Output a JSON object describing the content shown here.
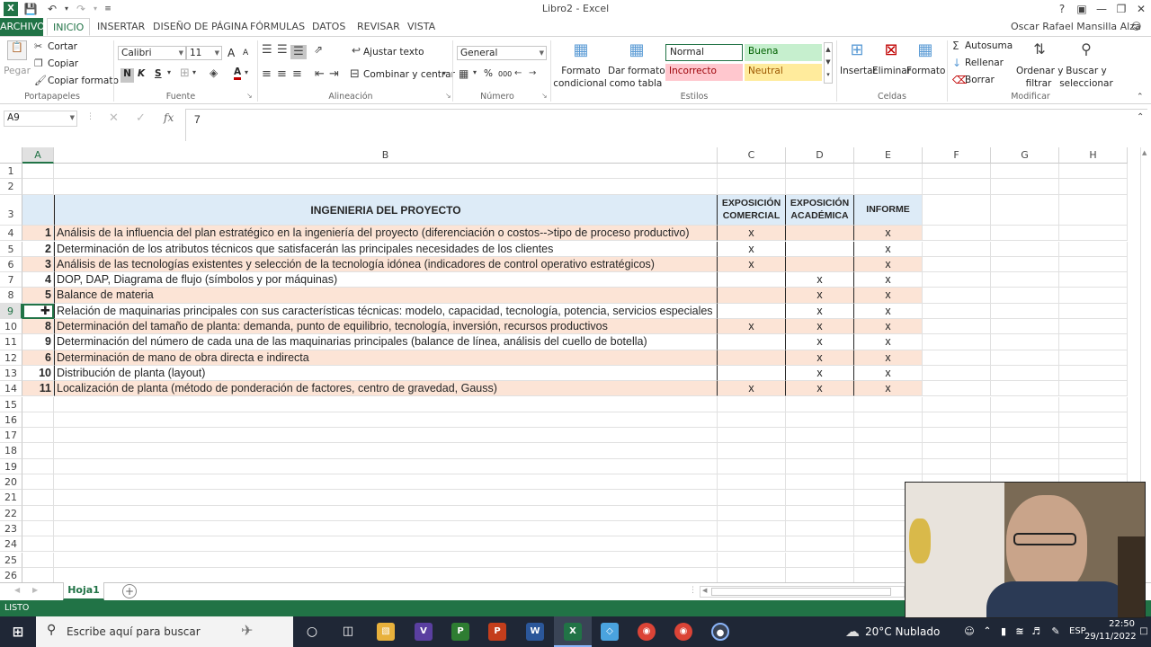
{
  "window": {
    "title": "Libro2 - Excel",
    "user": "Oscar Rafael Mansilla Alza",
    "help": "?"
  },
  "tabs": [
    "ARCHIVO",
    "INICIO",
    "INSERTAR",
    "DISEÑO DE PÁGINA",
    "FÓRMULAS",
    "DATOS",
    "REVISAR",
    "VISTA"
  ],
  "ribbon": {
    "clipboard": {
      "paste": "Pegar",
      "cut": "Cortar",
      "copy": "Copiar",
      "copy_format": "Copiar formato",
      "label": "Portapapeles"
    },
    "font": {
      "name": "Calibri",
      "size": "11",
      "bold": "N",
      "italic": "K",
      "underline": "S",
      "grow": "A",
      "shrink": "A",
      "color": "A",
      "label": "Fuente"
    },
    "alignment": {
      "wrap": "Ajustar texto",
      "merge": "Combinar y centrar",
      "label": "Alineación"
    },
    "number": {
      "format": "General",
      "percent": "%",
      "thousands": "000",
      "label": "Número"
    },
    "styles": {
      "cond_format_1": "Formato",
      "cond_format_2": "condicional",
      "table_format_1": "Dar formato",
      "table_format_2": "como tabla",
      "normal": "Normal",
      "good": "Buena",
      "bad": "Incorrecto",
      "neutral": "Neutral",
      "label": "Estilos"
    },
    "cells": {
      "insert": "Insertar",
      "delete": "Eliminar",
      "format": "Formato",
      "label": "Celdas"
    },
    "editing": {
      "autosum": "Autosuma",
      "fill": "Rellenar",
      "clear": "Borrar",
      "sort_1": "Ordenar y",
      "sort_2": "filtrar",
      "find_1": "Buscar y",
      "find_2": "seleccionar",
      "label": "Modificar"
    }
  },
  "formula_bar": {
    "name_box": "A9",
    "fx": "fx",
    "value": "7"
  },
  "columns": [
    "A",
    "B",
    "C",
    "D",
    "E",
    "F",
    "G",
    "H"
  ],
  "rows": [
    "1",
    "2",
    "3",
    "4",
    "5",
    "6",
    "7",
    "8",
    "9",
    "10",
    "11",
    "12",
    "13",
    "14",
    "15",
    "16",
    "17",
    "18",
    "19",
    "20",
    "21",
    "22",
    "23",
    "24",
    "25",
    "26"
  ],
  "table": {
    "title": "INGENIERIA DEL PROYECTO",
    "headers": [
      [
        "EXPOSICIÓN",
        "COMERCIAL"
      ],
      [
        "EXPOSICIÓN",
        "ACADÉMICA"
      ],
      [
        "INFORME"
      ]
    ],
    "items": [
      {
        "n": "1",
        "text": "Análisis de la influencia del plan estratégico en la ingeniería del proyecto (diferenciación o costos-->tipo de proceso productivo)",
        "c": "x",
        "d": "",
        "e": "x"
      },
      {
        "n": "2",
        "text": "Determinación de los atributos técnicos que satisfacerán las principales necesidades de los clientes",
        "c": "x",
        "d": "",
        "e": "x"
      },
      {
        "n": "3",
        "text": "Análisis de las tecnologías existentes y selección de la tecnología idónea (indicadores de control operativo estratégicos)",
        "c": "x",
        "d": "",
        "e": "x"
      },
      {
        "n": "4",
        "text": "DOP, DAP, Diagrama de flujo (símbolos y por máquinas)",
        "c": "",
        "d": "x",
        "e": "x"
      },
      {
        "n": "5",
        "text": "Balance de materia",
        "c": "",
        "d": "x",
        "e": "x"
      },
      {
        "n": "",
        "text": "Relación de maquinarias principales con sus características técnicas: modelo, capacidad, tecnología, potencia, servicios especiales",
        "c": "",
        "d": "x",
        "e": "x"
      },
      {
        "n": "8",
        "text": "Determinación del tamaño de planta: demanda, punto de equilibrio, tecnología, inversión, recursos productivos",
        "c": "x",
        "d": "x",
        "e": "x"
      },
      {
        "n": "9",
        "text": "Determinación del número de cada una de las maquinarias principales (balance de línea, análisis del cuello de botella)",
        "c": "",
        "d": "x",
        "e": "x"
      },
      {
        "n": "6",
        "text": "Determinación de mano de obra directa e indirecta",
        "c": "",
        "d": "x",
        "e": "x"
      },
      {
        "n": "10",
        "text": "Distribución de planta (layout)",
        "c": "",
        "d": "x",
        "e": "x"
      },
      {
        "n": "11",
        "text": "Localización de planta (método de ponderación de factores, centro de gravedad, Gauss)",
        "c": "x",
        "d": "x",
        "e": "x"
      }
    ]
  },
  "sheet_tab": "Hoja1",
  "status": "LISTO",
  "taskbar": {
    "search": "Escribe aquí para buscar",
    "weather": "20°C  Nublado",
    "lang": "ESP",
    "time": "22:50",
    "date": "29/11/2022"
  },
  "colors": {
    "accent": "#217346",
    "band": "#fce4d6",
    "header": "#ddebf7"
  }
}
